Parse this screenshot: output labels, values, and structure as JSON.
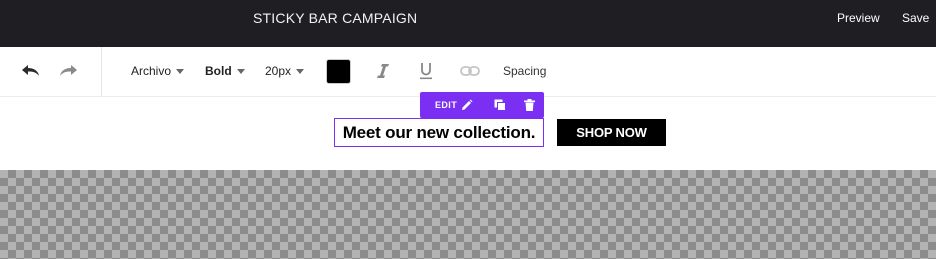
{
  "topbar": {
    "title": "STICKY BAR CAMPAIGN",
    "preview_label": "Preview",
    "save_label": "Save"
  },
  "toolbar": {
    "undo_icon": "undo-icon",
    "redo_icon": "redo-icon",
    "font_family": "Archivo",
    "font_weight": "Bold",
    "font_size": "20px",
    "text_color": "#000000",
    "italic_icon": "italic-icon",
    "underline_icon": "underline-icon",
    "link_icon": "link-icon",
    "spacing_label": "Spacing"
  },
  "edit_popup": {
    "edit_label": "EDIT",
    "accent_color": "#7b2ff2",
    "icons": [
      "pencil-icon",
      "duplicate-icon",
      "trash-icon"
    ]
  },
  "sticky_bar": {
    "headline": "Meet our new collection.",
    "cta_label": "SHOP NOW"
  }
}
